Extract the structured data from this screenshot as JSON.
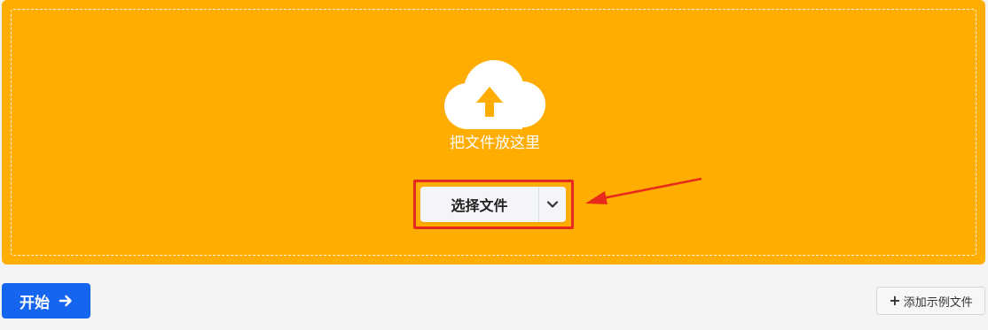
{
  "dropzone": {
    "label": "把文件放这里",
    "icon": "cloud-upload-icon",
    "bg_color": "#ffad00"
  },
  "file_picker": {
    "choose_label": "选择文件",
    "dropdown_icon": "chevron-down-icon",
    "highlight_color": "#e82a1c"
  },
  "actions": {
    "start_label": "开始",
    "start_icon": "arrow-right-icon",
    "start_color": "#1565f0",
    "sample_label": "添加示例文件",
    "sample_icon": "plus-icon"
  }
}
